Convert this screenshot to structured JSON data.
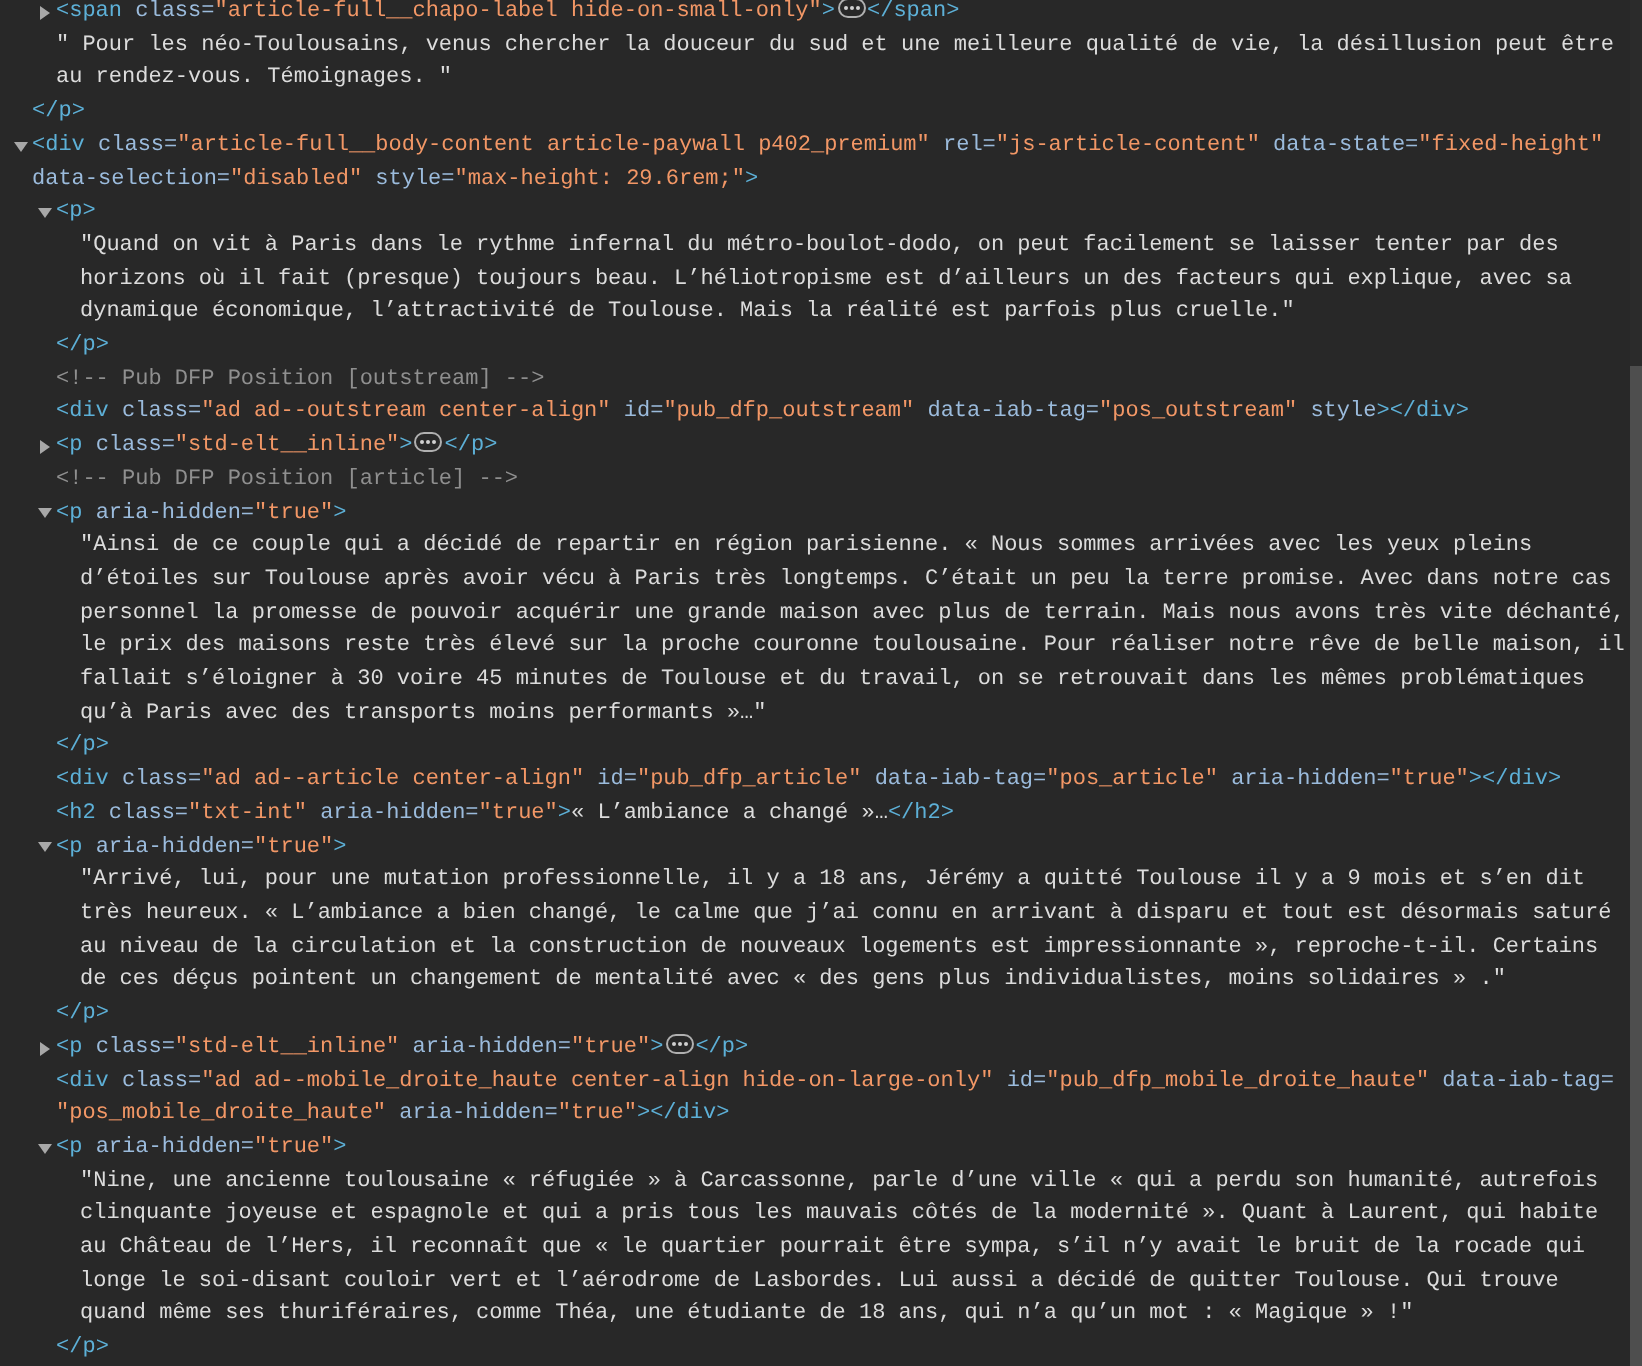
{
  "elements_panel": {
    "nodes": [
      {
        "kind": "element",
        "closing_tag": "</p>",
        "children": [
          {
            "kind": "element",
            "opening_tag": "<span class=\"article-full__chapo-label hide-on-small-only\">",
            "closing_tag": "</span>",
            "expanded": false
          },
          {
            "kind": "text",
            "text": "\" Pour les néo-Toulousains, venus chercher la douceur du sud et une meilleure qualité de vie, la désillusion peut être au rendez-vous. Témoignages. \""
          }
        ]
      },
      {
        "kind": "element",
        "opening_tag": "<div class=\"article-full__body-content article-paywall p402_premium\" rel=\"js-article-content\" data-state=\"fixed-height\" data-selection=\"disabled\" style=\"max-height: 29.6rem;\">",
        "expanded": true,
        "children": [
          {
            "kind": "element",
            "opening_tag": "<p>",
            "closing_tag": "</p>",
            "expanded": true,
            "children": [
              {
                "kind": "text",
                "text": "\"Quand on vit à Paris dans le rythme infernal du métro-boulot-dodo, on peut facilement se laisser tenter par des horizons où il fait (presque) toujours beau. L’héliotropisme est d’ailleurs un des facteurs qui explique, avec sa dynamique économique, l’attractivité de Toulouse. Mais la réalité est parfois plus cruelle.\""
              }
            ]
          },
          {
            "kind": "comment",
            "text": "<!-- Pub DFP Position [outstream] -->"
          },
          {
            "kind": "element",
            "opening_tag": "<div class=\"ad ad--outstream center-align\" id=\"pub_dfp_outstream\" data-iab-tag=\"pos_outstream\" style>",
            "closing_tag": "</div>"
          },
          {
            "kind": "element",
            "opening_tag": "<p class=\"std-elt__inline\">",
            "closing_tag": "</p>",
            "expanded": false
          },
          {
            "kind": "comment",
            "text": "<!-- Pub DFP Position [article] -->"
          },
          {
            "kind": "element",
            "opening_tag": "<p aria-hidden=\"true\">",
            "closing_tag": "</p>",
            "expanded": true,
            "children": [
              {
                "kind": "text",
                "text": "\"Ainsi de ce couple qui a décidé de repartir en région parisienne. « Nous sommes arrivées avec les yeux pleins d’étoiles sur Toulouse après avoir vécu à Paris très longtemps. C’était un peu la terre promise. Avec dans notre cas personnel la promesse de pouvoir acquérir une grande maison avec plus de terrain. Mais nous avons très vite déchanté, le prix des maisons reste très élevé sur la proche couronne toulousaine. Pour réaliser notre rêve de belle maison, il fallait s’éloigner à 30 voire 45 minutes de Toulouse et du travail, on se retrouvait dans les mêmes problématiques qu’à Paris avec des transports moins performants »…\""
              }
            ]
          },
          {
            "kind": "element",
            "opening_tag": "<div class=\"ad ad--article center-align\" id=\"pub_dfp_article\" data-iab-tag=\"pos_article\" aria-hidden=\"true\">",
            "closing_tag": "</div>"
          },
          {
            "kind": "element",
            "opening_tag": "<h2 class=\"txt-int\" aria-hidden=\"true\">",
            "inline_text": "« L’ambiance a changé »…",
            "closing_tag": "</h2>"
          },
          {
            "kind": "element",
            "opening_tag": "<p aria-hidden=\"true\">",
            "closing_tag": "</p>",
            "expanded": true,
            "children": [
              {
                "kind": "text",
                "text": "\"Arrivé, lui, pour une mutation professionnelle, il y a 18 ans, Jérémy a quitté Toulouse il y a 9 mois et s’en dit très heureux. « L’ambiance a bien changé, le calme que j’ai connu en arrivant à disparu et tout est désormais saturé au niveau de la circulation et la construction de nouveaux logements est impressionnante », reproche-t-il. Certains de ces déçus pointent un changement de mentalité avec « des gens plus individualistes, moins solidaires » .\""
              }
            ]
          },
          {
            "kind": "element",
            "opening_tag": "<p class=\"std-elt__inline\" aria-hidden=\"true\">",
            "closing_tag": "</p>",
            "expanded": false
          },
          {
            "kind": "element",
            "opening_tag": "<div class=\"ad ad--mobile_droite_haute center-align hide-on-large-only\" id=\"pub_dfp_mobile_droite_haute\" data-iab-tag=\"pos_mobile_droite_haute\" aria-hidden=\"true\">",
            "closing_tag": "</div>"
          },
          {
            "kind": "element",
            "opening_tag": "<p aria-hidden=\"true\">",
            "closing_tag": "</p>",
            "expanded": true,
            "children": [
              {
                "kind": "text",
                "text": "\"Nine, une ancienne toulousaine « réfugiée » à Carcassonne, parle d’une ville « qui a perdu son humanité, autrefois clinquante joyeuse et espagnole et qui a pris tous les mauvais côtés de la modernité ». Quant à Laurent, qui habite au Château de l’Hers, il reconnaît que « le quartier pourrait être sympa, s’il n’y avait le bruit de la rocade qui longe le soi-disant couloir vert et l’aérodrome de Lasbordes. Lui aussi a décidé de quitter Toulouse. Qui trouve quand même ses thuriféraires, comme Théa, une étudiante de 18 ans, qui n’a qu’un mot : « Magique » !\""
              }
            ]
          }
        ]
      }
    ]
  }
}
